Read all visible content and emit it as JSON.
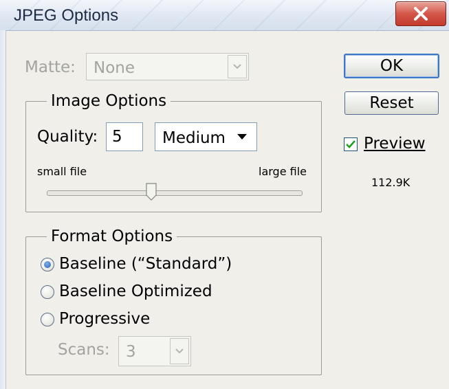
{
  "window": {
    "title": "JPEG Options"
  },
  "matte": {
    "label": "Matte:",
    "value": "None"
  },
  "image_options": {
    "legend": "Image Options",
    "quality_label": "Quality:",
    "quality_value": "5",
    "quality_preset": "Medium",
    "small_file_label": "small file",
    "large_file_label": "large file",
    "slider_fraction": 0.42
  },
  "format_options": {
    "legend": "Format Options",
    "options": [
      {
        "label": "Baseline (“Standard”)",
        "selected": true
      },
      {
        "label": "Baseline Optimized",
        "selected": false
      },
      {
        "label": "Progressive",
        "selected": false
      }
    ],
    "scans_label": "Scans:",
    "scans_value": "3"
  },
  "buttons": {
    "ok": "OK",
    "reset": "Reset"
  },
  "preview": {
    "label": "Preview",
    "checked": true,
    "file_size": "112.9K"
  },
  "colors": {
    "accent": "#3a77c4",
    "close_red": "#d4574a",
    "disabled_text": "#a3a3a0"
  }
}
